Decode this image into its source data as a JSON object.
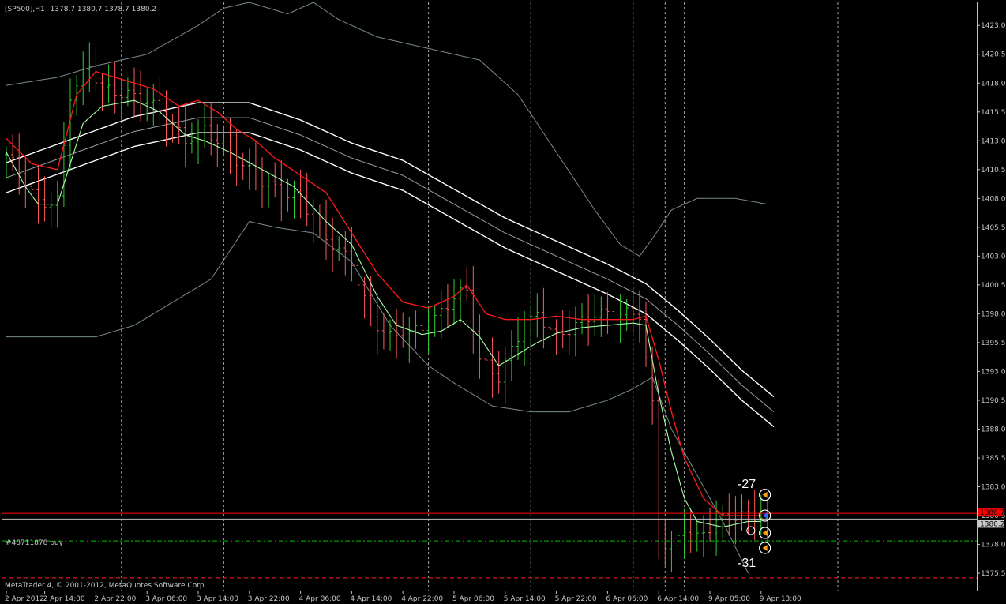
{
  "header": {
    "symbol": "[SP500],H1",
    "ohlc": "1378.7 1380.7 1378.7 1380.2"
  },
  "footer": {
    "copyright": "MetaTrader 4, © 2001-2012, MetaQuotes Software Corp."
  },
  "order_label": "#48711878 buy",
  "annotations": {
    "upper_value": "-27",
    "lower_value": "-31"
  },
  "price_tags": {
    "ask": "1380.7",
    "bid": "1380.2"
  },
  "colors": {
    "background": "#000000",
    "grid": "#c0c0c0",
    "axis": "#c0c0c0",
    "bull_candle": "#32cd32",
    "bear_candle": "#ff5a5a",
    "ema_fast": "#ff1a1a",
    "ema_slow": "#a8ffa8",
    "envelope": "#ffffff",
    "bollinger": "#7a8a8a",
    "ask_line": "#ff0000",
    "bid_line": "#c0c0c0",
    "order_line": "#00c000"
  },
  "chart_data": {
    "type": "candlestick",
    "symbol": "SP500",
    "timeframe": "H1",
    "ylim": [
      1374,
      1425
    ],
    "y_ticks": [
      "1423.0",
      "1420.5",
      "1418.0",
      "1415.5",
      "1413.0",
      "1410.5",
      "1408.0",
      "1405.5",
      "1403.0",
      "1400.5",
      "1398.0",
      "1395.5",
      "1393.0",
      "1390.5",
      "1388.0",
      "1385.5",
      "1383.0",
      "1380.5",
      "1378.0",
      "1375.5"
    ],
    "x_ticks": [
      {
        "label": "2 Apr 2012",
        "bar": 0
      },
      {
        "label": "2 Apr 14:00",
        "bar": 6
      },
      {
        "label": "2 Apr 22:00",
        "bar": 14
      },
      {
        "label": "3 Apr 06:00",
        "bar": 22
      },
      {
        "label": "3 Apr 14:00",
        "bar": 30
      },
      {
        "label": "3 Apr 22:00",
        "bar": 38
      },
      {
        "label": "4 Apr 06:00",
        "bar": 46
      },
      {
        "label": "4 Apr 14:00",
        "bar": 54
      },
      {
        "label": "4 Apr 22:00",
        "bar": 62
      },
      {
        "label": "5 Apr 06:00",
        "bar": 70
      },
      {
        "label": "5 Apr 14:00",
        "bar": 78
      },
      {
        "label": "5 Apr 22:00",
        "bar": 86
      },
      {
        "label": "6 Apr 06:00",
        "bar": 94
      },
      {
        "label": "6 Apr 14:00",
        "bar": 102
      },
      {
        "label": "9 Apr 05:00",
        "bar": 110
      },
      {
        "label": "9 Apr 13:00",
        "bar": 118
      }
    ],
    "grid_bars": [
      18,
      34,
      66,
      82,
      98,
      103,
      106,
      130
    ],
    "close_anchors": [
      [
        0,
        1411.8
      ],
      [
        3,
        1409.5
      ],
      [
        5,
        1407.5
      ],
      [
        8,
        1407.8
      ],
      [
        10,
        1417.0
      ],
      [
        13,
        1419.5
      ],
      [
        15,
        1417.5
      ],
      [
        19,
        1417.0
      ],
      [
        22,
        1416.5
      ],
      [
        25,
        1415.0
      ],
      [
        28,
        1413.0
      ],
      [
        31,
        1414.0
      ],
      [
        34,
        1412.5
      ],
      [
        37,
        1410.8
      ],
      [
        40,
        1409.5
      ],
      [
        43,
        1408.5
      ],
      [
        46,
        1408.0
      ],
      [
        50,
        1404.5
      ],
      [
        54,
        1402.5
      ],
      [
        57,
        1397.5
      ],
      [
        60,
        1396.0
      ],
      [
        64,
        1396.5
      ],
      [
        67,
        1397.5
      ],
      [
        70,
        1399.5
      ],
      [
        72,
        1400.0
      ],
      [
        74,
        1394.0
      ],
      [
        77,
        1392.5
      ],
      [
        80,
        1396.0
      ],
      [
        83,
        1398.0
      ],
      [
        86,
        1396.0
      ],
      [
        89,
        1397.0
      ],
      [
        92,
        1398.0
      ],
      [
        95,
        1398.0
      ],
      [
        99,
        1398.0
      ],
      [
        101,
        1390.0
      ],
      [
        102,
        1378.5
      ],
      [
        104,
        1377.5
      ],
      [
        106,
        1379.5
      ],
      [
        108,
        1378.5
      ],
      [
        111,
        1380.0
      ],
      [
        114,
        1380.5
      ],
      [
        116,
        1380.5
      ],
      [
        118,
        1380.5
      ],
      [
        119,
        1380.2
      ]
    ],
    "ema_fast_anchors": [
      [
        0,
        1413.2
      ],
      [
        4,
        1411.0
      ],
      [
        8,
        1410.5
      ],
      [
        11,
        1417.0
      ],
      [
        14,
        1419.0
      ],
      [
        17,
        1418.5
      ],
      [
        20,
        1418.0
      ],
      [
        23,
        1417.5
      ],
      [
        27,
        1416.0
      ],
      [
        30,
        1416.5
      ],
      [
        33,
        1415.5
      ],
      [
        36,
        1414.0
      ],
      [
        39,
        1413.0
      ],
      [
        42,
        1411.5
      ],
      [
        46,
        1410.0
      ],
      [
        50,
        1408.5
      ],
      [
        54,
        1405.0
      ],
      [
        58,
        1401.5
      ],
      [
        62,
        1399.0
      ],
      [
        66,
        1398.5
      ],
      [
        70,
        1399.5
      ],
      [
        72,
        1400.5
      ],
      [
        75,
        1398.0
      ],
      [
        78,
        1397.5
      ],
      [
        82,
        1397.5
      ],
      [
        86,
        1397.8
      ],
      [
        90,
        1397.5
      ],
      [
        94,
        1397.5
      ],
      [
        98,
        1397.5
      ],
      [
        100,
        1397.8
      ],
      [
        102,
        1394.0
      ],
      [
        104,
        1389.5
      ],
      [
        106,
        1385.5
      ],
      [
        109,
        1382.0
      ],
      [
        112,
        1380.5
      ],
      [
        115,
        1380.5
      ],
      [
        118,
        1380.5
      ]
    ],
    "ema_slow_anchors": [
      [
        0,
        1412.0
      ],
      [
        3,
        1409.0
      ],
      [
        5,
        1407.5
      ],
      [
        8,
        1407.5
      ],
      [
        10,
        1411.0
      ],
      [
        12,
        1414.5
      ],
      [
        15,
        1416.0
      ],
      [
        20,
        1416.5
      ],
      [
        24,
        1415.5
      ],
      [
        28,
        1413.5
      ],
      [
        31,
        1413.0
      ],
      [
        35,
        1412.0
      ],
      [
        40,
        1410.5
      ],
      [
        45,
        1409.0
      ],
      [
        50,
        1406.0
      ],
      [
        54,
        1404.0
      ],
      [
        58,
        1399.5
      ],
      [
        61,
        1397.0
      ],
      [
        65,
        1396.2
      ],
      [
        68,
        1396.5
      ],
      [
        71,
        1397.5
      ],
      [
        74,
        1396.0
      ],
      [
        77,
        1393.5
      ],
      [
        80,
        1394.5
      ],
      [
        83,
        1395.5
      ],
      [
        86,
        1396.3
      ],
      [
        90,
        1396.8
      ],
      [
        94,
        1397.0
      ],
      [
        98,
        1397.2
      ],
      [
        100,
        1397.0
      ],
      [
        102,
        1391.0
      ],
      [
        104,
        1386.0
      ],
      [
        106,
        1382.0
      ],
      [
        108,
        1380.0
      ],
      [
        112,
        1379.5
      ],
      [
        116,
        1380.0
      ],
      [
        118,
        1380.0
      ]
    ],
    "envelope_mid_anchors": [
      [
        0,
        1409.8
      ],
      [
        10,
        1411.8
      ],
      [
        20,
        1413.8
      ],
      [
        30,
        1415.0
      ],
      [
        38,
        1415.0
      ],
      [
        46,
        1413.5
      ],
      [
        54,
        1411.5
      ],
      [
        62,
        1410.0
      ],
      [
        70,
        1407.5
      ],
      [
        78,
        1405.0
      ],
      [
        86,
        1403.0
      ],
      [
        94,
        1401.0
      ],
      [
        100,
        1399.3
      ],
      [
        105,
        1397.0
      ],
      [
        110,
        1394.5
      ],
      [
        115,
        1391.8
      ],
      [
        120,
        1389.5
      ]
    ],
    "envelope_offset": 1.3,
    "bollinger_upper_anchors": [
      [
        0,
        1417.8
      ],
      [
        8,
        1418.5
      ],
      [
        14,
        1419.5
      ],
      [
        22,
        1420.5
      ],
      [
        30,
        1423.0
      ],
      [
        34,
        1424.5
      ],
      [
        38,
        1425.0
      ],
      [
        44,
        1424.0
      ],
      [
        48,
        1425.0
      ],
      [
        52,
        1423.5
      ],
      [
        58,
        1422.0
      ],
      [
        66,
        1421.0
      ],
      [
        74,
        1420.0
      ],
      [
        80,
        1417.0
      ],
      [
        86,
        1412.0
      ],
      [
        92,
        1407.0
      ],
      [
        96,
        1404.0
      ],
      [
        99,
        1403.0
      ],
      [
        101,
        1404.5
      ],
      [
        104,
        1407.0
      ],
      [
        108,
        1408.0
      ],
      [
        114,
        1408.0
      ],
      [
        119,
        1407.5
      ]
    ],
    "bollinger_lower_anchors": [
      [
        0,
        1396.0
      ],
      [
        8,
        1396.0
      ],
      [
        14,
        1396.0
      ],
      [
        20,
        1397.0
      ],
      [
        26,
        1399.0
      ],
      [
        32,
        1401.0
      ],
      [
        38,
        1406.0
      ],
      [
        42,
        1405.5
      ],
      [
        48,
        1405.0
      ],
      [
        54,
        1402.5
      ],
      [
        60,
        1397.0
      ],
      [
        66,
        1393.5
      ],
      [
        70,
        1392.0
      ],
      [
        76,
        1390.0
      ],
      [
        82,
        1389.5
      ],
      [
        88,
        1389.5
      ],
      [
        94,
        1390.5
      ],
      [
        98,
        1391.5
      ],
      [
        101,
        1392.5
      ],
      [
        104,
        1388.0
      ],
      [
        108,
        1384.0
      ],
      [
        112,
        1380.0
      ],
      [
        116,
        1375.5
      ]
    ],
    "ask": 1380.7,
    "bid": 1380.2,
    "order_price": 1378.3,
    "stop_price": 1375.1
  }
}
